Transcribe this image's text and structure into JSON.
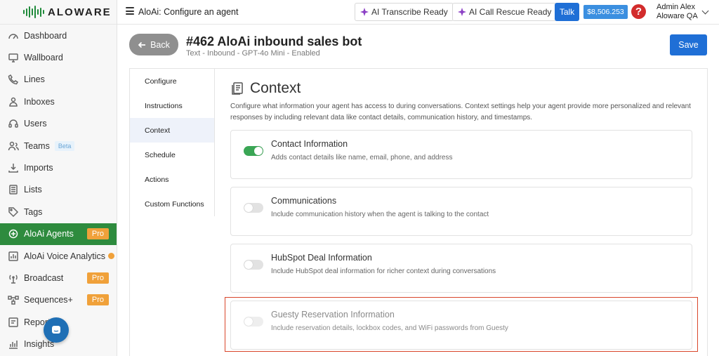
{
  "brand": {
    "name": "ALOWARE",
    "accent": "#2e8b3e"
  },
  "sidebar": {
    "items": [
      {
        "label": "Dashboard",
        "icon": "dashboard-icon"
      },
      {
        "label": "Wallboard",
        "icon": "monitor-icon"
      },
      {
        "label": "Lines",
        "icon": "phone-icon"
      },
      {
        "label": "Inboxes",
        "icon": "inbox-icon"
      },
      {
        "label": "Users",
        "icon": "headset-icon"
      },
      {
        "label": "Teams",
        "icon": "users-icon",
        "badge": "Beta"
      },
      {
        "label": "Imports",
        "icon": "download-icon"
      },
      {
        "label": "Lists",
        "icon": "list-icon"
      },
      {
        "label": "Tags",
        "icon": "tag-icon"
      },
      {
        "label": "AloAi Agents",
        "icon": "brain-icon",
        "badge": "Pro",
        "active": true
      },
      {
        "label": "AloAi Voice Analytics",
        "icon": "analytics-icon"
      },
      {
        "label": "Broadcast",
        "icon": "broadcast-icon",
        "badge": "Pro"
      },
      {
        "label": "Sequences+",
        "icon": "sequence-icon",
        "badge": "Pro"
      },
      {
        "label": "Reports",
        "icon": "report-icon"
      },
      {
        "label": "Insights",
        "icon": "chart-icon"
      }
    ]
  },
  "topbar": {
    "title": "AloAi: Configure an agent",
    "transcribe": "AI Transcribe Ready",
    "rescue": "AI Call Rescue Ready",
    "talk": "Talk",
    "balance": "$8,506.253",
    "user_name": "Admin Alex",
    "user_org": "Aloware QA"
  },
  "page": {
    "back": "Back",
    "title": "#462 AloAi inbound sales bot",
    "subtitle": "Text - Inbound - GPT-4o Mini - Enabled",
    "save": "Save"
  },
  "tabs": [
    "Configure",
    "Instructions",
    "Context",
    "Schedule",
    "Actions",
    "Custom Functions"
  ],
  "context": {
    "title": "Context",
    "description": "Configure what information your agent has access to during conversations. Context settings help your agent provide more personalized and relevant responses by including relevant data like contact details, communication history, and timestamps.",
    "cards": [
      {
        "title": "Contact Information",
        "desc": "Adds contact details like name, email, phone, and address",
        "enabled": true
      },
      {
        "title": "Communications",
        "desc": "Include communication history when the agent is talking to the contact",
        "enabled": false
      },
      {
        "title": "HubSpot Deal Information",
        "desc": "Include HubSpot deal information for richer context during conversations",
        "enabled": false
      },
      {
        "title": "Guesty Reservation Information",
        "desc": "Include reservation details, lockbox codes, and WiFi passwords from Guesty",
        "enabled": false
      }
    ]
  }
}
